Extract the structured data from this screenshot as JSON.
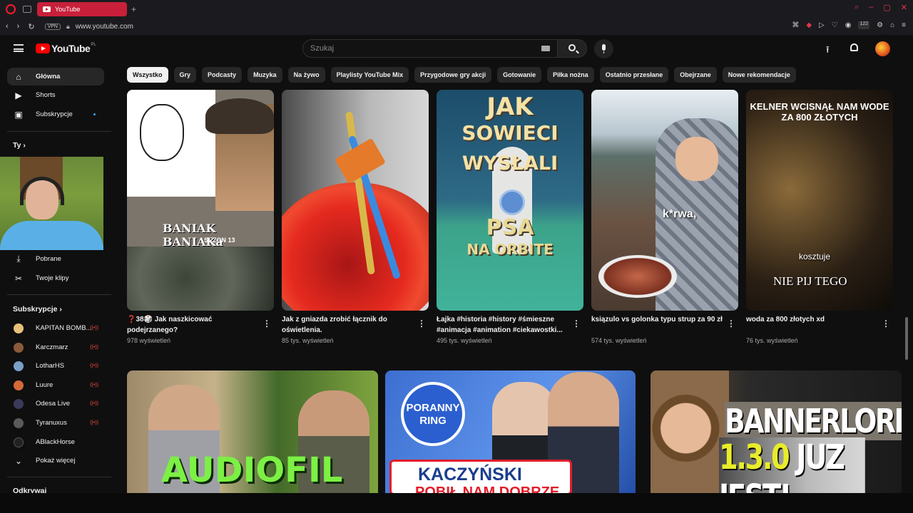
{
  "browser": {
    "tab_title": "YouTube",
    "new_tab": "+",
    "vpn_label": "VPN",
    "url": "www.youtube.com",
    "badge": "122"
  },
  "header": {
    "logo_text": "YouTube",
    "region": "PL",
    "search_placeholder": "Szukaj"
  },
  "sidebar": {
    "main": [
      {
        "label": "Główna",
        "icon": "home-icon"
      },
      {
        "label": "Shorts",
        "icon": "shorts-icon"
      },
      {
        "label": "Subskrypcje",
        "icon": "subscriptions-icon"
      }
    ],
    "you_heading": "Ty",
    "you_items": [
      {
        "label": "Pobrane",
        "icon": "download-icon"
      },
      {
        "label": "Twoje klipy",
        "icon": "scissors-icon"
      }
    ],
    "subs_heading": "Subskrypcje",
    "subscriptions": [
      {
        "name": "KAPITAN BOMB...",
        "color": "#e8c07a"
      },
      {
        "name": "Karczmarz",
        "color": "#8a5a3a"
      },
      {
        "name": "LotharHS",
        "color": "#7aa0c8"
      },
      {
        "name": "Luure",
        "color": "#d46a3a"
      },
      {
        "name": "Odesa Live",
        "color": "#3a3a5a"
      },
      {
        "name": "Tyranuxus",
        "color": "#5a5a5a"
      },
      {
        "name": "ABlackHorse",
        "color": "#222222"
      }
    ],
    "show_more": "Pokaż więcej",
    "explore_heading": "Odkrywaj"
  },
  "chips": [
    "Wszystko",
    "Gry",
    "Podcasty",
    "Muzyka",
    "Na żywo",
    "Playlisty YouTube Mix",
    "Przygodowe gry akcji",
    "Gotowanie",
    "Piłka nożna",
    "Ostatnio przesłane",
    "Obejrzane",
    "Nowe rekomendacje"
  ],
  "shorts": [
    {
      "title": "❓38🎲 Jak naszkicować podejrzanego?",
      "views": "978 wyświetleń",
      "overlay": "BANIAK BANIAKa",
      "overlay2": "SEZON 13"
    },
    {
      "title": "Jak z gniazda zrobić łącznik do oświetlenia.",
      "views": "85 tys. wyświetleń"
    },
    {
      "title": "Łajka #historia #history #śmieszne #animacja #animation #ciekawostki...",
      "views": "495 tys. wyświetleń",
      "overlay_lines": [
        "JAK",
        "SOWIECI",
        "WYSŁALI",
        "PSA",
        "NA ORBITE"
      ]
    },
    {
      "title": "ksiązulo vs golonka typu strup za 90 zł",
      "views": "574 tys. wyświetleń",
      "overlay": "k*rwa,"
    },
    {
      "title": "woda za 800 złotych xd",
      "views": "76 tys. wyświetleń",
      "overlay_top": "KELNER WCISNĄŁ NAM WODE ZA 800 ZŁOTYCH",
      "overlay_mid": "kosztuje",
      "overlay_bottom": "NIE PIJ TEGO"
    }
  ],
  "videos": [
    {
      "overlay": "AUDIOFIL"
    },
    {
      "overlay_ring": "PORANNY RING",
      "overlay1": "KACZYŃSKI",
      "overlay2": "POBIŁ NAM DOBRZE"
    },
    {
      "overlay1": "BANNERLORD",
      "overlay2_yellow": "1.3.0",
      "overlay2_rest": " JUZ JEST!"
    }
  ]
}
